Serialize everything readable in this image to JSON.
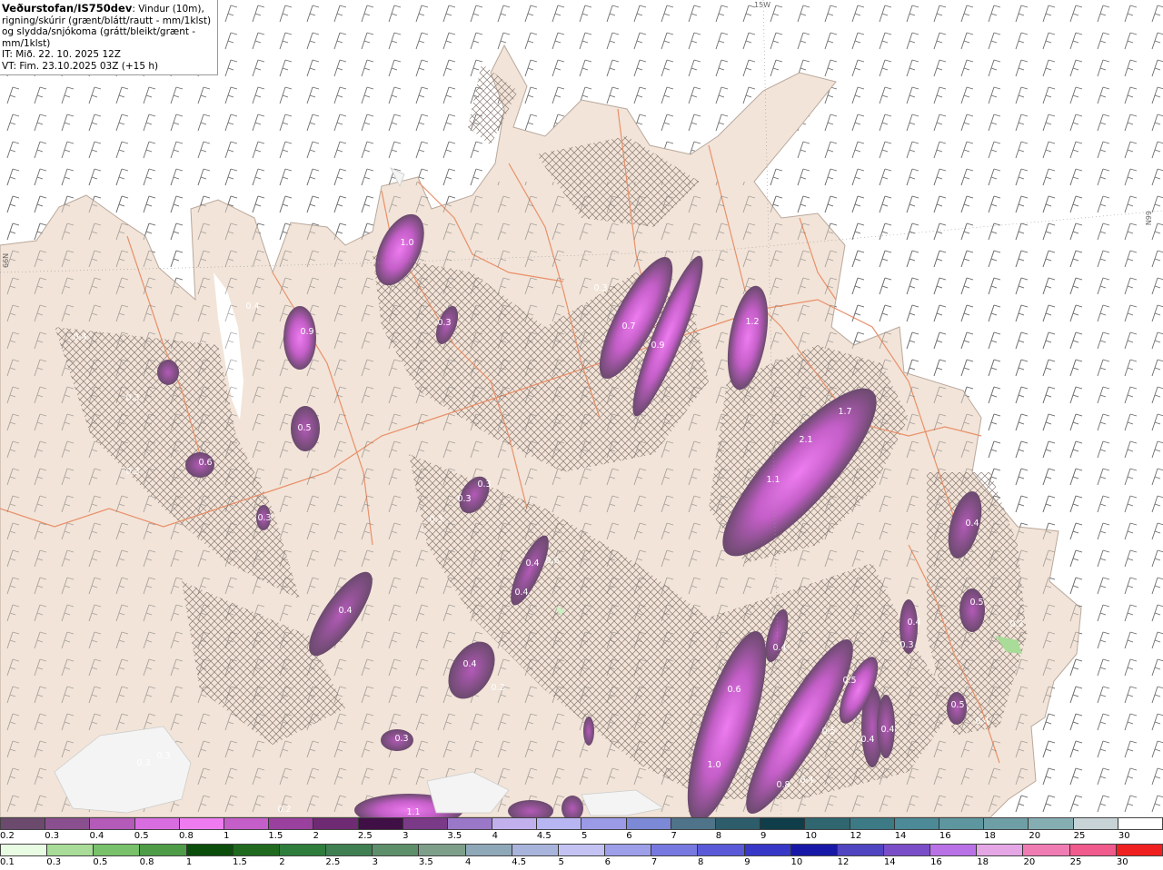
{
  "info": {
    "title": "Veðurstofan/IS750dev",
    "desc": ": Vindur (10m), rigning/skúrir (grænt/blátt/rautt - mm/1klst) og slydda/snjókoma (grátt/bleikt/grænt - mm/1klst)",
    "it": "IT: Mið. 22. 10. 2025 12Z",
    "vt": "VT: Fim. 23.10.2025 03Z (+15 h)"
  },
  "grid_labels": {
    "top": "15W",
    "left": "66N",
    "right": "66N"
  },
  "colors": {
    "sea": "#ffffff",
    "land": "#f2e4d8",
    "road": "#e9906a",
    "hatch": "#8a7a72"
  },
  "legend_snow": {
    "labels": [
      "0.2",
      "0.3",
      "0.4",
      "0.5",
      "0.8",
      "1",
      "1.5",
      "2",
      "2.5",
      "3",
      "3.5",
      "4",
      "4.5",
      "5",
      "6",
      "7",
      "8",
      "9",
      "10",
      "12",
      "14",
      "16",
      "18",
      "20",
      "25",
      "30"
    ],
    "colors": [
      "#6b4a6e",
      "#8a4f8f",
      "#b45ab8",
      "#d86de0",
      "#ee7cf0",
      "#c45ec8",
      "#9a409e",
      "#6e2a72",
      "#3f0f45",
      "#7a3a88",
      "#9a77c7",
      "#c2b0ec",
      "#b7b5f2",
      "#9b9ae6",
      "#7c89d6",
      "#4f7389",
      "#2d5c6a",
      "#103d4a",
      "#2f6670",
      "#3c7a86",
      "#4b8a96",
      "#5d969f",
      "#6f9fa6",
      "#85aeb3",
      "#c7d3d6",
      "#ffffff"
    ]
  },
  "legend_rain": {
    "labels": [
      "0.1",
      "0.3",
      "0.5",
      "0.8",
      "1",
      "1.5",
      "2",
      "2.5",
      "3",
      "3.5",
      "4",
      "4.5",
      "5",
      "6",
      "7",
      "8",
      "9",
      "10",
      "12",
      "14",
      "16",
      "18",
      "20",
      "25",
      "30"
    ],
    "colors": [
      "#e8fbe3",
      "#a8dc98",
      "#78c06a",
      "#4e9c48",
      "#0b4d0b",
      "#1f6a1f",
      "#2e7d3c",
      "#3f7f52",
      "#5e8f6b",
      "#7d9f8a",
      "#8fa8b8",
      "#a9b4dc",
      "#c3c2f2",
      "#9d9fe9",
      "#7879e0",
      "#5a5ad8",
      "#3838c8",
      "#1818a8",
      "#5044c0",
      "#7a4ec8",
      "#b872e6",
      "#e4a6e4",
      "#f07cb4",
      "#f05a8c",
      "#f02020"
    ]
  },
  "precip_labels": [
    "1.0",
    "0.9",
    "0.3",
    "0.5",
    "0.4",
    "0.4",
    "0.3",
    "0.6",
    "0.3",
    "0.3",
    "0.3",
    "0.3",
    "0.7",
    "0.9",
    "1.2",
    "0.3",
    "1.7",
    "2.1",
    "1.1",
    "0.4",
    "0.4",
    "0.4",
    "0.6",
    "0.4",
    "0.3",
    "0.4",
    "0.4",
    "0.3",
    "0.5",
    "0.6",
    "0.4",
    "0.5",
    "0.4",
    "0.4",
    "1.0",
    "0.5",
    "0.8",
    "0.2",
    "0.3",
    "0.3",
    "1.1",
    "0.2",
    "0.5",
    "0.3",
    "0.4",
    "0.4",
    "0.2"
  ]
}
